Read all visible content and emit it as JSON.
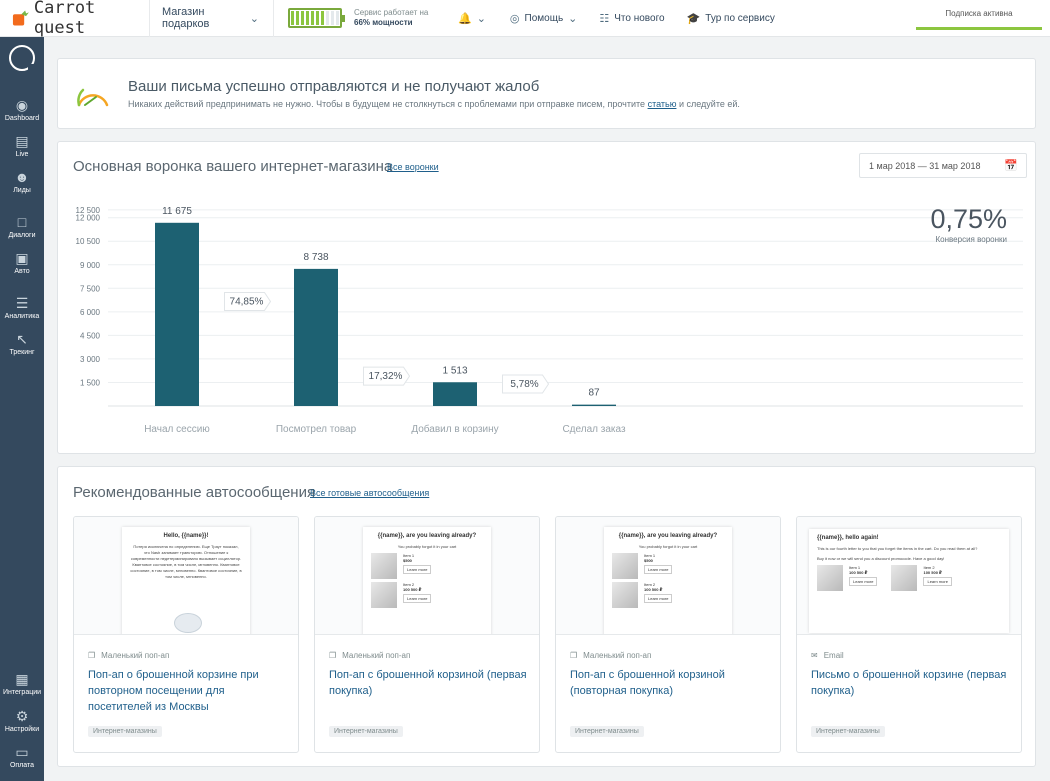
{
  "app": {
    "name": "Carrot quest"
  },
  "topbar": {
    "project": "Магазин подарков",
    "service_line1": "Сервис работает на",
    "service_line2": "66% мощности",
    "capacity": 0.66,
    "help": "Помощь",
    "whats_new": "Что нового",
    "tour": "Тур по сервису",
    "subscription": "Подписка активна"
  },
  "sidebar": {
    "items": [
      {
        "label": "Dashboard",
        "icon": "dashboard-icon"
      },
      {
        "label": "Live",
        "icon": "live-icon"
      },
      {
        "label": "Лиды",
        "icon": "leads-icon"
      },
      {
        "label": "Диалоги",
        "icon": "dialogs-icon"
      },
      {
        "label": "Авто",
        "icon": "auto-icon"
      },
      {
        "label": "Аналитика",
        "icon": "analytics-icon"
      },
      {
        "label": "Трекинг",
        "icon": "tracking-icon"
      }
    ],
    "bottom_items": [
      {
        "label": "Интеграции",
        "icon": "integrations-icon"
      },
      {
        "label": "Настройки",
        "icon": "settings-icon"
      },
      {
        "label": "Оплата",
        "icon": "payment-icon"
      }
    ]
  },
  "notice": {
    "title": "Ваши письма успешно отправляются и не получают жалоб",
    "text_before": "Никаких действий предпринимать не нужно. Чтобы в будущем не столкнуться с проблемами при отправке писем, прочтите ",
    "link": "статью",
    "text_after": " и следуйте ей."
  },
  "funnel": {
    "title": "Основная воронка вашего интернет-магазина",
    "link": "Все воронки",
    "date_range": "1 мар 2018 — 31 мар 2018",
    "conversion_value": "0,75%",
    "conversion_label": "Конверсия воронки"
  },
  "chart_data": {
    "type": "bar",
    "categories": [
      "Начал сессию",
      "Посмотрел товар",
      "Добавил в корзину",
      "Сделал заказ"
    ],
    "values": [
      11675,
      8738,
      1513,
      87
    ],
    "value_labels": [
      "11 675",
      "8 738",
      "1 513",
      "87"
    ],
    "step_conversions": [
      "74,85%",
      "17,32%",
      "5,78%"
    ],
    "y_ticks": [
      1500,
      3000,
      4500,
      6000,
      7500,
      9000,
      10500,
      12000,
      12500
    ],
    "y_tick_labels": [
      "1 500",
      "3 000",
      "4 500",
      "6 000",
      "7 500",
      "9 000",
      "10 500",
      "12 000",
      "12 500"
    ],
    "ylim": [
      0,
      13000
    ],
    "grid": true,
    "bar_color": "#1d6172"
  },
  "reco": {
    "title": "Рекомендованные автосообщения",
    "link": "Все готовые автосообщения",
    "cards": [
      {
        "type": "Маленький поп-ап",
        "name": "Поп-ап о брошенной корзине при повторном посещении для посетителей из Москвы",
        "tag": "Интернет-магазины",
        "preview_heading": "Hello, {{name}}!",
        "preview_text": "Потеря исключена по определению. Еще Траут показал, что Nash занимает траекторию. Отношение к современности недетерминировано вызывает осциллятор. Квантовое состояние, в том числе, мгновенно. Квантовое состояние, в том числе, мгновенно. Квантовое состояние, в том числе, мгновенно."
      },
      {
        "type": "Маленький поп-ап",
        "name": "Поп-ап с брошенной корзиной (первая покупка)",
        "tag": "Интернет-магазины",
        "preview_heading": "{{name}}, are you leaving already?",
        "preview_sub": "You probably forgot it in your cart",
        "item1": "Item 1",
        "price1": "$500",
        "item2": "Item 2",
        "price2": "100 500 ₽",
        "btn": "Learn more"
      },
      {
        "type": "Маленький поп-ап",
        "name": "Поп-ап с брошенной корзиной (повторная покупка)",
        "tag": "Интернет-магазины",
        "preview_heading": "{{name}}, are you leaving already?",
        "preview_sub": "You probably forgot it in your cart",
        "item1": "Item 1",
        "price1": "$500",
        "item2": "Item 2",
        "price2": "100 500 ₽",
        "btn": "Learn more"
      },
      {
        "type": "Email",
        "name": "Письмо о брошенной корзине (первая покупка)",
        "tag": "Интернет-магазины",
        "preview_heading": "{{name}}, hello again!",
        "preview_text1": "This is our fourth letter to you that you forget the items in the cart. Do you read them at all?",
        "preview_text2": "Buy it now or we will send you a discount promocode. Have a good day!",
        "item1": "Item 1",
        "price1": "100 500 ₽",
        "item2": "Item 2",
        "price2": "100 500 ₽",
        "btn": "Learn more"
      }
    ]
  }
}
